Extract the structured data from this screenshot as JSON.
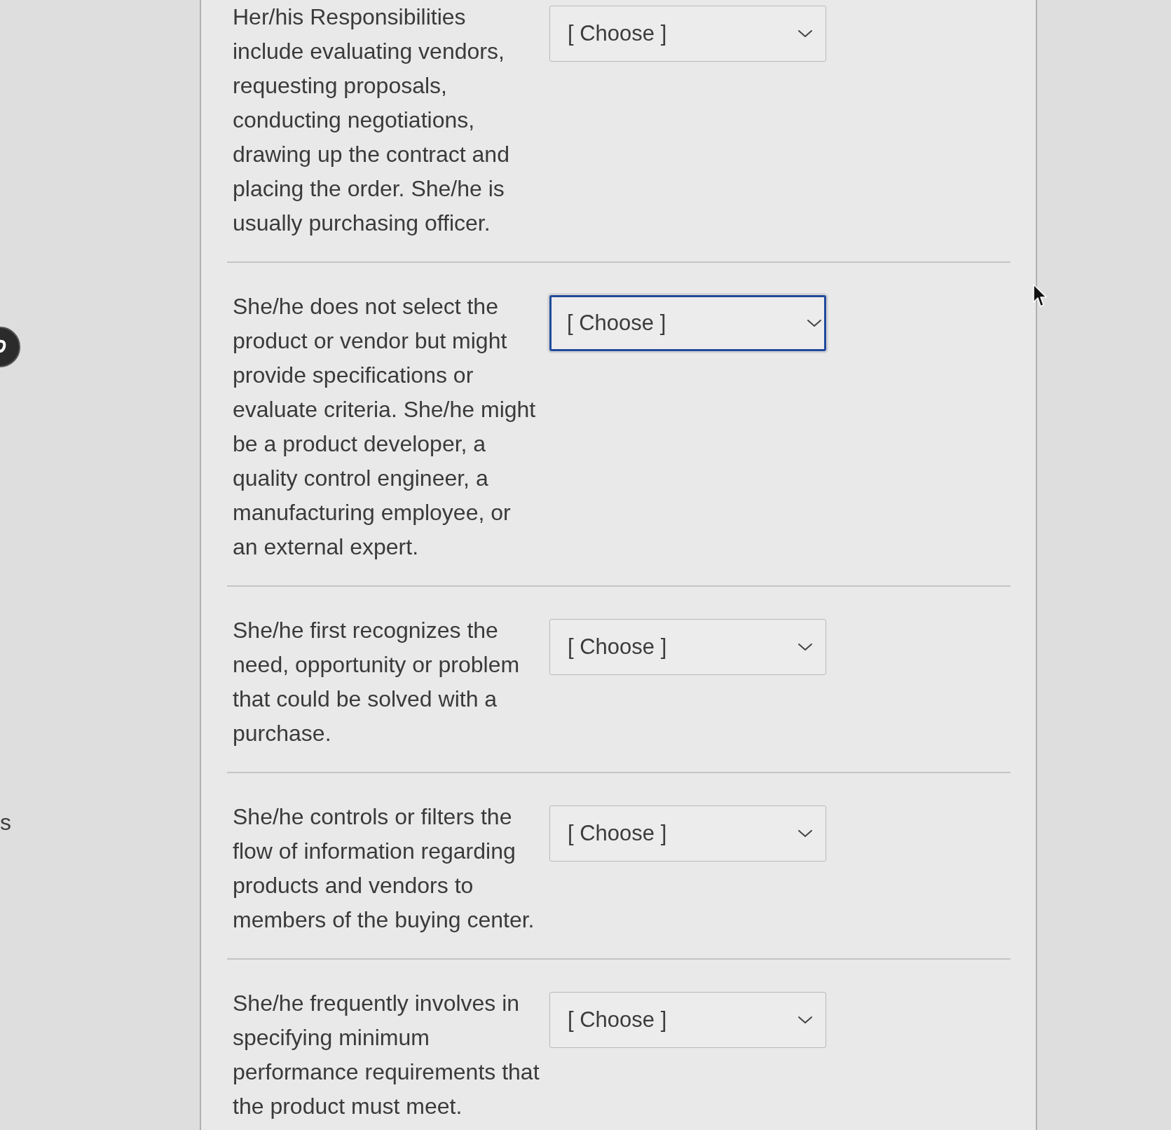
{
  "margin_text": "s",
  "questions": [
    {
      "text": "Her/his Responsibilities include evaluating vendors, requesting proposals, conducting negotiations, drawing up the contract and placing the order. She/he is usually purchasing officer.",
      "dropdown": {
        "value": "[ Choose ]",
        "focused": false
      }
    },
    {
      "text": "She/he does not select the product or vendor but might provide specifications or evaluate criteria. She/he might be a product developer, a quality control engineer, a manufacturing employee, or an external expert.",
      "dropdown": {
        "value": "[ Choose ]",
        "focused": true
      }
    },
    {
      "text": "She/he first recognizes the need, opportunity or problem that could be solved with a purchase.",
      "dropdown": {
        "value": "[ Choose ]",
        "focused": false
      }
    },
    {
      "text": "She/he controls or filters the flow of information regarding products and vendors to members of the buying center.",
      "dropdown": {
        "value": "[ Choose ]",
        "focused": false
      }
    },
    {
      "text": "She/he frequently involves in specifying minimum performance requirements that the product must meet.",
      "dropdown": {
        "value": "[ Choose ]",
        "focused": false
      }
    }
  ]
}
